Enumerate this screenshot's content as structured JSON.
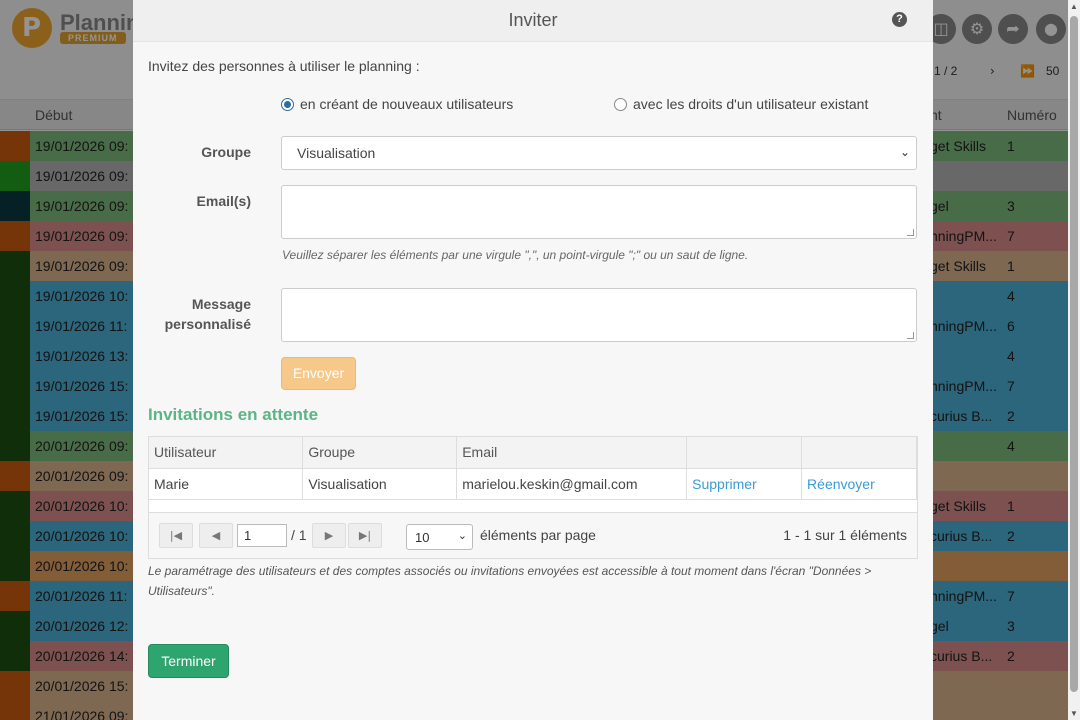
{
  "background": {
    "app_title": "Planning",
    "badge": "PREMIUM",
    "pager_text": "1 / 2",
    "page_size": "50",
    "columns": {
      "start": "Début",
      "project": "nt",
      "number": "Numéro"
    },
    "rows": [
      {
        "date": "19/01/2026 09:",
        "project": "get Skills",
        "num": "1",
        "color": "#7dba7d",
        "stripe": "#cc5a10"
      },
      {
        "date": "19/01/2026 09:",
        "project": "",
        "num": "",
        "color": "#b3b3b3",
        "stripe": "#22a022"
      },
      {
        "date": "19/01/2026 09:",
        "project": "gel",
        "num": "3",
        "color": "#7dba7d",
        "stripe": "#0a3a40"
      },
      {
        "date": "19/01/2026 09:",
        "project": "nningPM...",
        "num": "7",
        "color": "#d98c8c",
        "stripe": "#cc5a10"
      },
      {
        "date": "19/01/2026 09:",
        "project": "get Skills",
        "num": "1",
        "color": "#d9b48c",
        "stripe": "#1a5010"
      },
      {
        "date": "19/01/2026 10:",
        "project": "",
        "num": "4",
        "color": "#4ab0d8",
        "stripe": "#1a5010"
      },
      {
        "date": "19/01/2026 11:",
        "project": "nningPM...",
        "num": "6",
        "color": "#4ab0d8",
        "stripe": "#1a5010"
      },
      {
        "date": "19/01/2026 13:",
        "project": "",
        "num": "4",
        "color": "#4ab0d8",
        "stripe": "#1a5010"
      },
      {
        "date": "19/01/2026 15:",
        "project": "nningPM...",
        "num": "7",
        "color": "#4ab0d8",
        "stripe": "#1a5010"
      },
      {
        "date": "19/01/2026 15:",
        "project": "curius B...",
        "num": "2",
        "color": "#4ab0d8",
        "stripe": "#1a5010"
      },
      {
        "date": "20/01/2026 09:",
        "project": "",
        "num": "4",
        "color": "#7dba7d",
        "stripe": "#1a5010"
      },
      {
        "date": "20/01/2026 09:",
        "project": "",
        "num": "",
        "color": "#d9b48c",
        "stripe": "#cc5a10"
      },
      {
        "date": "20/01/2026 10:",
        "project": "get Skills",
        "num": "1",
        "color": "#d98c8c",
        "stripe": "#1a5010"
      },
      {
        "date": "20/01/2026 10:",
        "project": "curius B...",
        "num": "2",
        "color": "#4ab0d8",
        "stripe": "#1a5010"
      },
      {
        "date": "20/01/2026 10:",
        "project": "",
        "num": "",
        "color": "#e0a060",
        "stripe": "#1a5010"
      },
      {
        "date": "20/01/2026 11:",
        "project": "nningPM...",
        "num": "7",
        "color": "#4ab0d8",
        "stripe": "#cc5a10"
      },
      {
        "date": "20/01/2026 12:",
        "project": "gel",
        "num": "3",
        "color": "#4ab0d8",
        "stripe": "#1a5010"
      },
      {
        "date": "20/01/2026 14:",
        "project": "curius B...",
        "num": "2",
        "color": "#d98c8c",
        "stripe": "#1a5010"
      },
      {
        "date": "20/01/2026 15:",
        "project": "",
        "num": "",
        "color": "#d9b48c",
        "stripe": "#cc5a10"
      },
      {
        "date": "21/01/2026 09:",
        "project": "",
        "num": "",
        "color": "#d9b48c",
        "stripe": "#cc5a10"
      }
    ]
  },
  "modal": {
    "title": "Inviter",
    "help": "?",
    "intro": "Invitez des personnes à utiliser le planning :",
    "radio_new": "en créant de nouveaux utilisateurs",
    "radio_existing": "avec les droits d'un utilisateur existant",
    "group_label": "Groupe",
    "group_value": "Visualisation",
    "emails_label": "Email(s)",
    "emails_value": "",
    "emails_hint": "Veuillez séparer les éléments par une virgule \",\", un point-virgule \";\" ou un saut de ligne.",
    "message_label_1": "Message",
    "message_label_2": "personnalisé",
    "message_value": "",
    "send_label": "Envoyer",
    "pending_title": "Invitations en attente",
    "table": {
      "headers": [
        "Utilisateur",
        "Groupe",
        "Email",
        "",
        ""
      ],
      "rows": [
        {
          "user": "Marie",
          "group": "Visualisation",
          "email": "marielou.keskin@gmail.com",
          "delete": "Supprimer",
          "resend": "Réenvoyer"
        }
      ]
    },
    "pager": {
      "page": "1",
      "total": "/ 1",
      "page_size": "10",
      "per_page_label": "éléments par page",
      "info": "1 - 1 sur 1 éléments"
    },
    "footer_note": "Le paramétrage des utilisateurs et des comptes associés ou invitations envoyées est accessible à tout moment dans l'écran \"Données > Utilisateurs\".",
    "done_label": "Terminer"
  }
}
